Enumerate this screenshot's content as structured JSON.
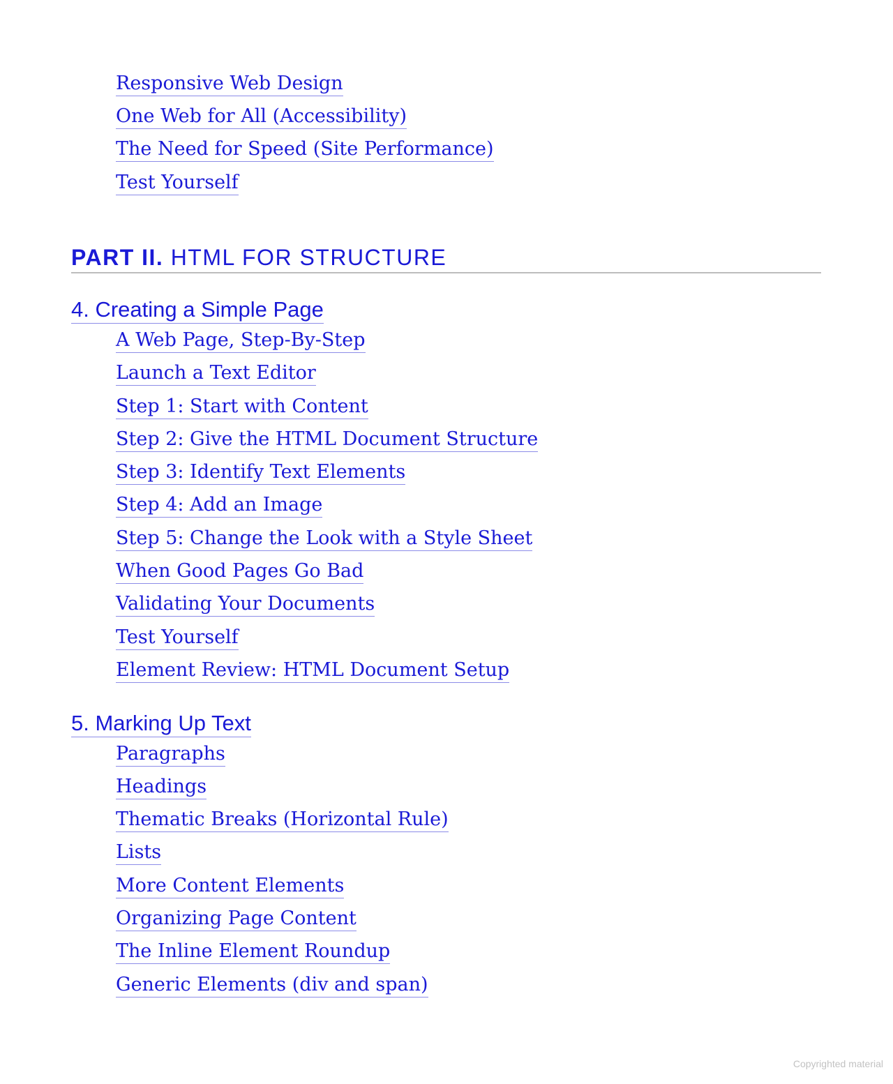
{
  "top_section": {
    "items": [
      "Responsive Web Design",
      "One Web for All (Accessibility)",
      "The Need for Speed (Site Performance)",
      "Test Yourself"
    ]
  },
  "part": {
    "label": "PART II.",
    "title": "HTML FOR STRUCTURE"
  },
  "chapters": [
    {
      "title": "4. Creating a Simple Page",
      "items": [
        "A Web Page, Step-By-Step",
        "Launch a Text Editor",
        "Step 1: Start with Content",
        "Step 2: Give the HTML Document Structure",
        "Step 3: Identify Text Elements",
        "Step 4: Add an Image",
        "Step 5: Change the Look with a Style Sheet",
        "When Good Pages Go Bad",
        "Validating Your Documents",
        "Test Yourself",
        "Element Review: HTML Document Setup"
      ]
    },
    {
      "title": "5. Marking Up Text",
      "items": [
        "Paragraphs",
        "Headings",
        "Thematic Breaks (Horizontal Rule)",
        "Lists",
        "More Content Elements",
        "Organizing Page Content",
        "The Inline Element Roundup",
        "Generic Elements (div and span)"
      ]
    }
  ],
  "footer": {
    "note": "Copyrighted material"
  },
  "colors": {
    "link": "#1a1ad6",
    "underline": "#8c8ce8",
    "rule": "#bdbdbd",
    "footer_text": "#c2c2c2"
  }
}
